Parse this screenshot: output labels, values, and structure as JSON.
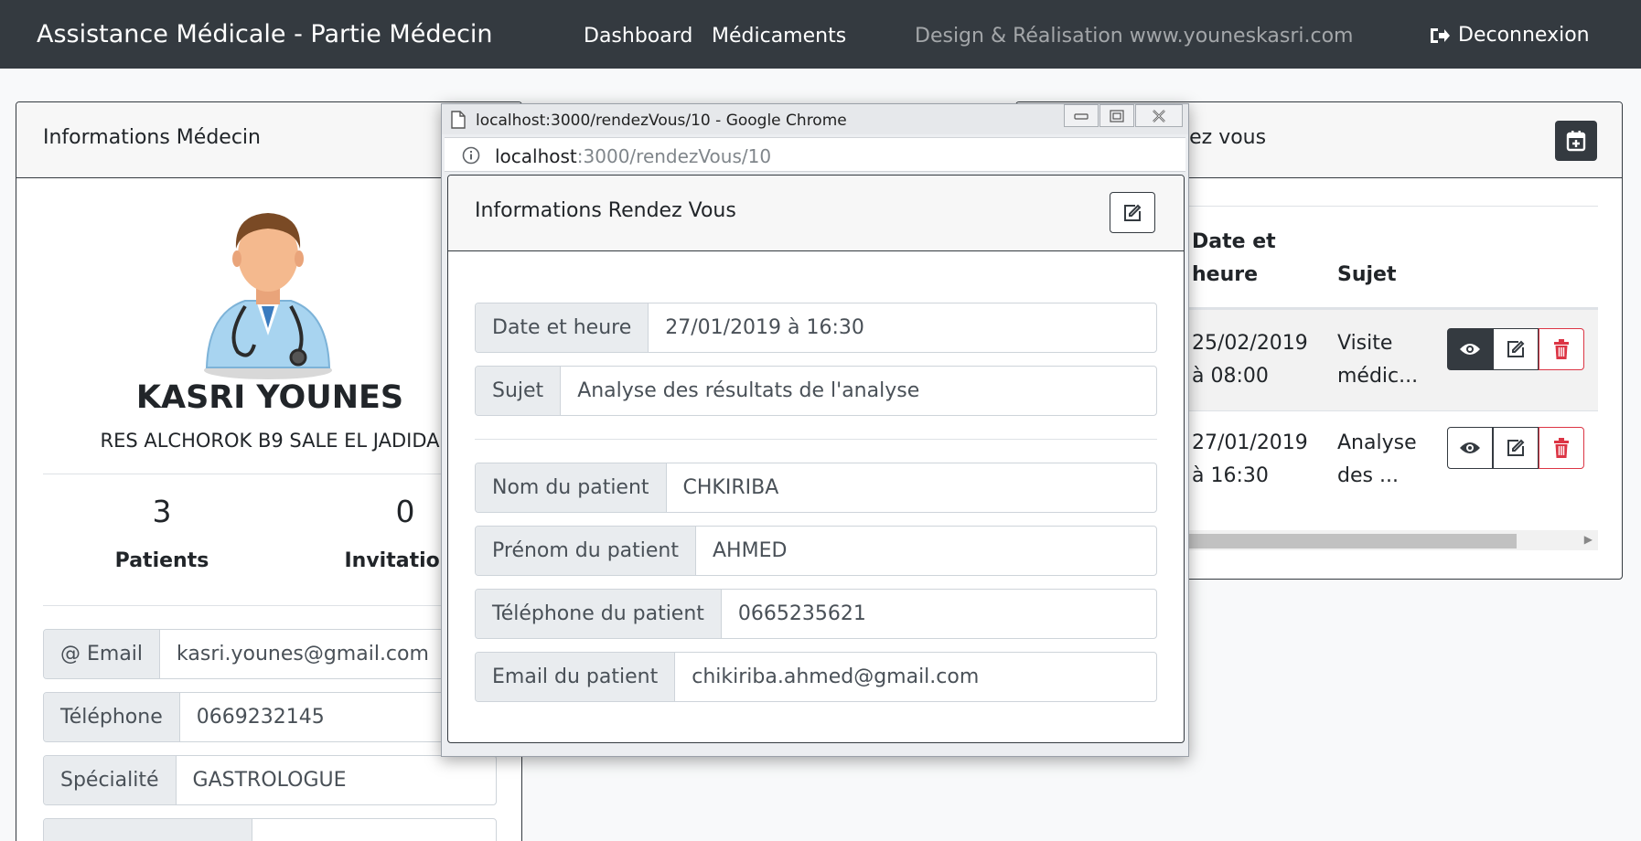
{
  "navbar": {
    "brand": "Assistance Médicale - Partie Médecin",
    "links": [
      "Dashboard",
      "Médicaments"
    ],
    "credit": "Design & Réalisation www.youneskasri.com",
    "logout": "Deconnexion"
  },
  "left_card": {
    "title": "Informations Médecin",
    "name": "KASRI YOUNES",
    "address": "RES ALCHOROK B9 SALE EL JADIDA",
    "stats": [
      {
        "value": "3",
        "label": "Patients"
      },
      {
        "value": "0",
        "label": "Invitations"
      }
    ],
    "fields": [
      {
        "label": "@ Email",
        "value": "kasri.younes@gmail.com"
      },
      {
        "label": "Téléphone",
        "value": "0669232145"
      },
      {
        "label": "Spécialité",
        "value": "GASTROLOGUE"
      }
    ]
  },
  "right_card": {
    "title_visible": "lez vous",
    "columns": {
      "date": "Date et\nheure",
      "subject": "Sujet"
    },
    "rows": [
      {
        "date_line1": "25/02/2019",
        "date_line2": "à 08:00",
        "subject_line1": "Visite",
        "subject_line2": "médic..."
      },
      {
        "date_line1": "27/01/2019",
        "date_line2": "à 16:30",
        "subject_line1": "Analyse",
        "subject_line2": "des ..."
      }
    ]
  },
  "popup": {
    "window_title": "localhost:3000/rendezVous/10 - Google Chrome",
    "url_host": "localhost",
    "url_path": ":3000/rendezVous/10",
    "card_title": "Informations Rendez Vous",
    "appointment_fields": [
      {
        "label": "Date et heure",
        "value": "27/01/2019 à 16:30"
      },
      {
        "label": "Sujet",
        "value": "Analyse des résultats de l'analyse"
      }
    ],
    "patient_fields": [
      {
        "label": "Nom du patient",
        "value": "CHKIRIBA"
      },
      {
        "label": "Prénom du patient",
        "value": "AHMED"
      },
      {
        "label": "Téléphone du patient",
        "value": "0665235621"
      },
      {
        "label": "Email du patient",
        "value": "chikiriba.ahmed@gmail.com"
      }
    ]
  },
  "colors": {
    "navbar": "#343a40",
    "danger": "#dc3545",
    "background": "#f8f9fa"
  }
}
